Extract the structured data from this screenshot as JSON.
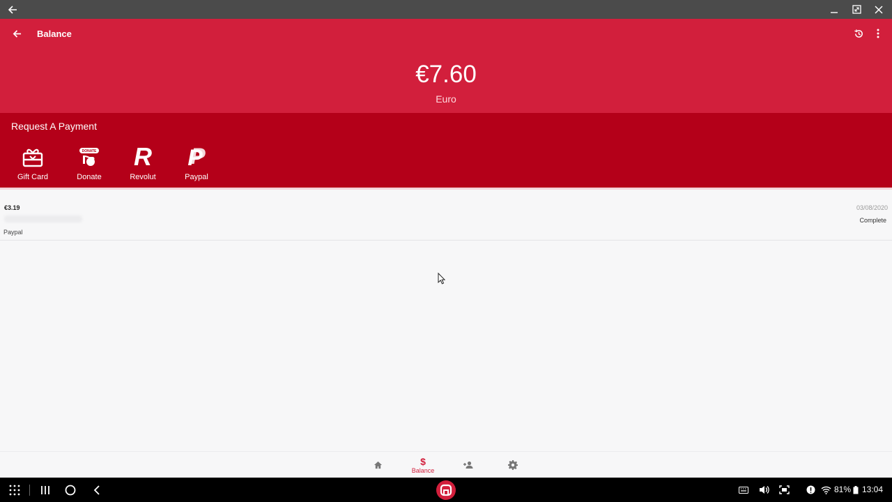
{
  "header": {
    "title": "Balance",
    "balance_amount": "€7.60",
    "currency": "Euro"
  },
  "request_payment": {
    "title": "Request A Payment",
    "options": [
      {
        "label": "Gift Card",
        "icon": "gift-card-icon"
      },
      {
        "label": "Donate",
        "icon": "donate-icon",
        "badge": "DONATE"
      },
      {
        "label": "Revolut",
        "icon": "revolut-icon",
        "glyph": "R"
      },
      {
        "label": "Paypal",
        "icon": "paypal-icon",
        "glyph": "P"
      }
    ]
  },
  "transactions": [
    {
      "amount": "€3.19",
      "method": "Paypal",
      "date": "03/08/2020",
      "status": "Complete"
    }
  ],
  "bottom_nav": {
    "items": [
      {
        "icon": "home-icon",
        "label": ""
      },
      {
        "icon": "dollar-icon",
        "label": "Balance",
        "glyph": "$",
        "active": true
      },
      {
        "icon": "add-person-icon",
        "label": ""
      },
      {
        "icon": "settings-icon",
        "label": ""
      }
    ]
  },
  "system_bar": {
    "battery_percent": "81%",
    "clock": "13:04"
  },
  "colors": {
    "header": "#d21f3c",
    "request_band": "#b40019",
    "accent": "#d21f3c",
    "window_bar": "#4b4b4b"
  }
}
